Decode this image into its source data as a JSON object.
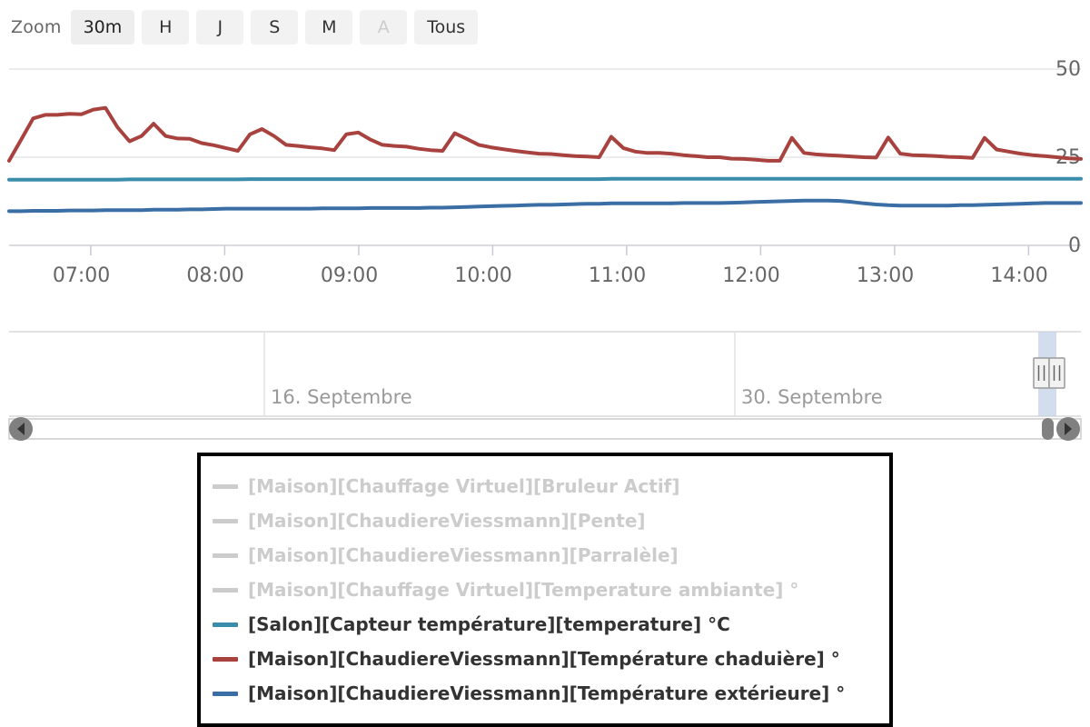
{
  "range_selector": {
    "label": "Zoom",
    "buttons": [
      {
        "label": "30m",
        "state": "selected"
      },
      {
        "label": "H",
        "state": "normal"
      },
      {
        "label": "J",
        "state": "normal"
      },
      {
        "label": "S",
        "state": "normal"
      },
      {
        "label": "M",
        "state": "normal"
      },
      {
        "label": "A",
        "state": "disabled"
      },
      {
        "label": "Tous",
        "state": "normal"
      }
    ]
  },
  "navigator": {
    "labels": [
      "16. Septembre",
      "30. Septembre"
    ],
    "left_arrow_icon": "chevron-left-icon",
    "right_arrow_icon": "chevron-right-icon",
    "handle_left_icon": "grip-handle-icon",
    "handle_right_icon": "grip-handle-icon"
  },
  "legend": {
    "items": [
      {
        "label": "[Maison][Chauffage Virtuel][Bruleur Actif]",
        "color": "#cccccc",
        "visible": false
      },
      {
        "label": "[Maison][ChaudiereViessmann][Pente]",
        "color": "#cccccc",
        "visible": false
      },
      {
        "label": "[Maison][ChaudiereViessmann][Parralèle]",
        "color": "#cccccc",
        "visible": false
      },
      {
        "label": "[Maison][Chauffage Virtuel][Temperature ambiante] °",
        "color": "#cccccc",
        "visible": false
      },
      {
        "label": "[Salon][Capteur température][temperature] °C",
        "color": "#3c8dab",
        "visible": true
      },
      {
        "label": "[Maison][ChaudiereViessmann][Température chaduière] °",
        "color": "#a8423f",
        "visible": true
      },
      {
        "label": "[Maison][ChaudiereViessmann][Température extérieure] °",
        "color": "#3a6ea5",
        "visible": true
      }
    ]
  },
  "chart_data": {
    "type": "line",
    "title": "",
    "xlabel": "",
    "ylabel": "",
    "grid": true,
    "legend_position": "bottom",
    "xticks": [
      "07:00",
      "08:00",
      "09:00",
      "10:00",
      "11:00",
      "12:00",
      "13:00",
      "14:00"
    ],
    "yticks": [
      0,
      25,
      50
    ],
    "ylim": [
      0,
      50
    ],
    "xlim": [
      "06:55",
      "14:25"
    ],
    "x": [
      "06:55",
      "07:00",
      "07:05",
      "07:10",
      "07:15",
      "07:20",
      "07:25",
      "07:30",
      "07:35",
      "07:40",
      "07:45",
      "07:50",
      "07:55",
      "08:00",
      "08:05",
      "08:10",
      "08:15",
      "08:20",
      "08:25",
      "08:30",
      "08:35",
      "08:40",
      "08:45",
      "08:50",
      "08:55",
      "09:00",
      "09:05",
      "09:10",
      "09:15",
      "09:20",
      "09:25",
      "09:30",
      "09:35",
      "09:40",
      "09:45",
      "09:50",
      "09:55",
      "10:00",
      "10:05",
      "10:10",
      "10:15",
      "10:20",
      "10:25",
      "10:30",
      "10:35",
      "10:40",
      "10:45",
      "10:50",
      "10:55",
      "11:00",
      "11:05",
      "11:10",
      "11:15",
      "11:20",
      "11:25",
      "11:30",
      "11:35",
      "11:40",
      "11:45",
      "11:50",
      "11:55",
      "12:00",
      "12:05",
      "12:10",
      "12:15",
      "12:20",
      "12:25",
      "12:30",
      "12:35",
      "12:40",
      "12:45",
      "12:50",
      "12:55",
      "13:00",
      "13:05",
      "13:10",
      "13:15",
      "13:20",
      "13:25",
      "13:30",
      "13:35",
      "13:40",
      "13:45",
      "13:50",
      "13:55",
      "14:00",
      "14:05",
      "14:10",
      "14:15",
      "14:20"
    ],
    "series": [
      {
        "name": "[Maison][ChaudiereViessmann][Température chaduière] °",
        "color": "#a8423f",
        "unit": "°C",
        "values": [
          24.0,
          30.0,
          36.0,
          37.0,
          37.0,
          37.3,
          37.2,
          38.5,
          39.0,
          33.5,
          29.5,
          31.0,
          34.5,
          31.0,
          30.3,
          30.2,
          29.0,
          28.4,
          27.6,
          26.8,
          31.5,
          33.0,
          31.0,
          28.5,
          28.2,
          27.8,
          27.5,
          27.0,
          31.5,
          32.0,
          30.0,
          28.5,
          28.2,
          28.0,
          27.4,
          27.0,
          26.8,
          31.8,
          30.2,
          28.5,
          27.8,
          27.3,
          26.8,
          26.4,
          26.0,
          25.9,
          25.6,
          25.3,
          25.2,
          25.0,
          30.8,
          27.6,
          26.6,
          26.2,
          26.2,
          26.0,
          25.6,
          25.3,
          25.0,
          25.0,
          24.6,
          24.5,
          24.3,
          24.0,
          24.0,
          30.5,
          26.2,
          25.8,
          25.6,
          25.4,
          25.2,
          25.0,
          24.9,
          30.6,
          26.0,
          25.6,
          25.5,
          25.3,
          25.1,
          25.0,
          24.8,
          30.5,
          27.2,
          26.6,
          26.0,
          25.6,
          25.3,
          25.0,
          24.7,
          24.5
        ]
      },
      {
        "name": "[Salon][Capteur température][temperature] °C",
        "color": "#3c8dab",
        "unit": "°C",
        "values": [
          18.6,
          18.6,
          18.6,
          18.6,
          18.6,
          18.6,
          18.6,
          18.6,
          18.6,
          18.6,
          18.7,
          18.7,
          18.7,
          18.7,
          18.7,
          18.7,
          18.7,
          18.7,
          18.7,
          18.7,
          18.8,
          18.8,
          18.8,
          18.8,
          18.8,
          18.8,
          18.8,
          18.8,
          18.8,
          18.8,
          18.8,
          18.8,
          18.8,
          18.8,
          18.8,
          18.8,
          18.8,
          18.8,
          18.8,
          18.8,
          18.8,
          18.8,
          18.8,
          18.8,
          18.8,
          18.8,
          18.8,
          18.8,
          18.8,
          18.8,
          18.9,
          18.9,
          18.9,
          18.9,
          18.9,
          18.9,
          18.9,
          18.9,
          18.9,
          18.9,
          18.9,
          18.9,
          18.9,
          18.9,
          18.9,
          18.9,
          18.9,
          18.9,
          18.9,
          18.9,
          18.9,
          18.9,
          18.9,
          18.9,
          18.9,
          18.9,
          18.9,
          18.9,
          18.9,
          18.9,
          18.9,
          18.9,
          18.9,
          18.9,
          18.9,
          18.9,
          18.9,
          18.9,
          18.9,
          18.9
        ]
      },
      {
        "name": "[Maison][ChaudiereViessmann][Température extérieure] °",
        "color": "#3a6ea5",
        "unit": "°C",
        "values": [
          9.7,
          9.7,
          9.8,
          9.8,
          9.8,
          9.9,
          9.9,
          9.9,
          10.0,
          10.0,
          10.0,
          10.0,
          10.1,
          10.1,
          10.1,
          10.2,
          10.2,
          10.3,
          10.4,
          10.4,
          10.4,
          10.4,
          10.4,
          10.4,
          10.4,
          10.4,
          10.5,
          10.5,
          10.5,
          10.5,
          10.6,
          10.6,
          10.6,
          10.6,
          10.6,
          10.7,
          10.7,
          10.8,
          10.9,
          11.0,
          11.1,
          11.2,
          11.3,
          11.4,
          11.5,
          11.5,
          11.6,
          11.7,
          11.8,
          11.8,
          11.9,
          11.9,
          11.9,
          11.9,
          11.9,
          11.9,
          12.0,
          12.0,
          12.0,
          12.0,
          12.1,
          12.2,
          12.3,
          12.4,
          12.5,
          12.6,
          12.7,
          12.7,
          12.7,
          12.6,
          12.3,
          11.9,
          11.6,
          11.4,
          11.3,
          11.3,
          11.3,
          11.3,
          11.3,
          11.4,
          11.4,
          11.5,
          11.6,
          11.7,
          11.8,
          11.9,
          12.0,
          12.0,
          12.0,
          12.0
        ]
      }
    ]
  }
}
